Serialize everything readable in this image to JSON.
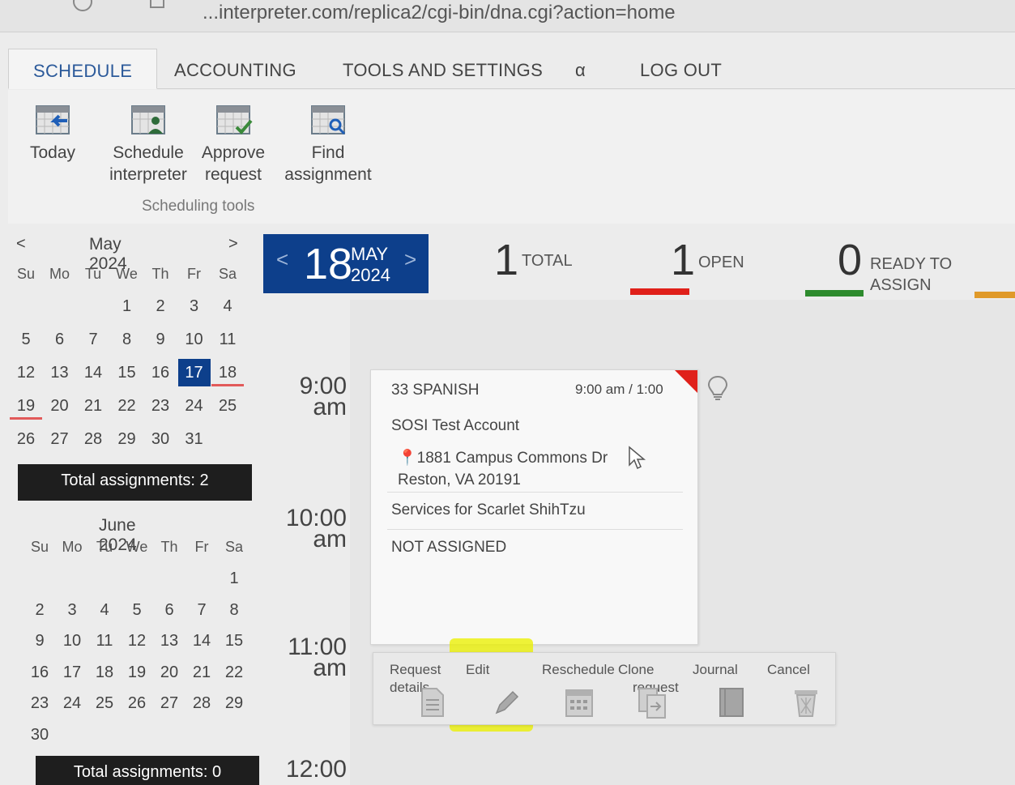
{
  "browser": {
    "url_text": "...interpreter.com/replica2/cgi-bin/dna.cgi?action=home"
  },
  "tabs": [
    {
      "label": "SCHEDULE",
      "active": true
    },
    {
      "label": "ACCOUNTING"
    },
    {
      "label": "TOOLS AND SETTINGS"
    },
    {
      "label": "α"
    },
    {
      "label": "LOG OUT"
    }
  ],
  "toolbar": {
    "today": {
      "label": "Today",
      "icon": "calendar-arrow-icon"
    },
    "schedule": {
      "line1": "Schedule",
      "line2": "interpreter",
      "icon": "calendar-person-icon"
    },
    "approve": {
      "line1": "Approve",
      "line2": "request",
      "icon": "calendar-check-icon"
    },
    "find": {
      "line1": "Find",
      "line2": "assignment",
      "icon": "calendar-search-icon"
    },
    "group_label": "Scheduling tools"
  },
  "calendar_may": {
    "title": "May 2024",
    "prev": "<",
    "next": ">",
    "dow": [
      "Su",
      "Mo",
      "Tu",
      "We",
      "Th",
      "Fr",
      "Sa"
    ],
    "days": [
      "1",
      "2",
      "3",
      "4",
      "5",
      "6",
      "7",
      "8",
      "9",
      "10",
      "11",
      "12",
      "13",
      "14",
      "15",
      "16",
      "17",
      "18",
      "19",
      "20",
      "21",
      "22",
      "23",
      "24",
      "25",
      "26",
      "27",
      "28",
      "29",
      "30",
      "31"
    ],
    "selected": "17",
    "total": "Total assignments: 2"
  },
  "calendar_june": {
    "title": "June 2024",
    "dow": [
      "Su",
      "Mo",
      "Tu",
      "We",
      "Th",
      "Fr",
      "Sa"
    ],
    "days": [
      "1",
      "2",
      "3",
      "4",
      "5",
      "6",
      "7",
      "8",
      "9",
      "10",
      "11",
      "12",
      "13",
      "14",
      "15",
      "16",
      "17",
      "18",
      "19",
      "20",
      "21",
      "22",
      "23",
      "24",
      "25",
      "26",
      "27",
      "28",
      "29",
      "30"
    ],
    "total": "Total assignments: 0"
  },
  "date_header": {
    "day": "18",
    "month": "MAY",
    "year": "2024",
    "prev": "<",
    "next": ">"
  },
  "stats": [
    {
      "count": "1",
      "label1": "TOTAL",
      "label2": "",
      "color": ""
    },
    {
      "count": "1",
      "label1": "OPEN",
      "label2": "",
      "color": "#e0201a"
    },
    {
      "count": "0",
      "label1": "READY TO",
      "label2": "ASSIGN",
      "color": "#2e8b2e"
    }
  ],
  "time_slots": [
    {
      "time": "9:00",
      "ampm": "am"
    },
    {
      "time": "10:00",
      "ampm": "am"
    },
    {
      "time": "11:00",
      "ampm": "am"
    },
    {
      "time": "12:00",
      "ampm": ""
    }
  ],
  "assignment": {
    "title": "33 SPANISH",
    "time": "9:00 am / 1:00",
    "account": "SOSI Test Account",
    "address1": "1881 Campus Commons Dr",
    "address2": "Reston, VA 20191",
    "services": "Services for Scarlet ShihTzu",
    "status": "NOT ASSIGNED",
    "status_color": "#e0201a"
  },
  "actions": [
    {
      "line1": "Request",
      "line2": "details",
      "icon": "document-icon"
    },
    {
      "line1": "Edit",
      "line2": "",
      "icon": "pencil-icon"
    },
    {
      "line1": "Reschedule",
      "line2": "",
      "icon": "calendar-icon"
    },
    {
      "line1": "Clone",
      "line2": "request",
      "icon": "clone-icon"
    },
    {
      "line1": "Journal",
      "line2": "",
      "icon": "journal-icon"
    },
    {
      "line1": "Cancel",
      "line2": "",
      "icon": "trash-icon"
    }
  ]
}
